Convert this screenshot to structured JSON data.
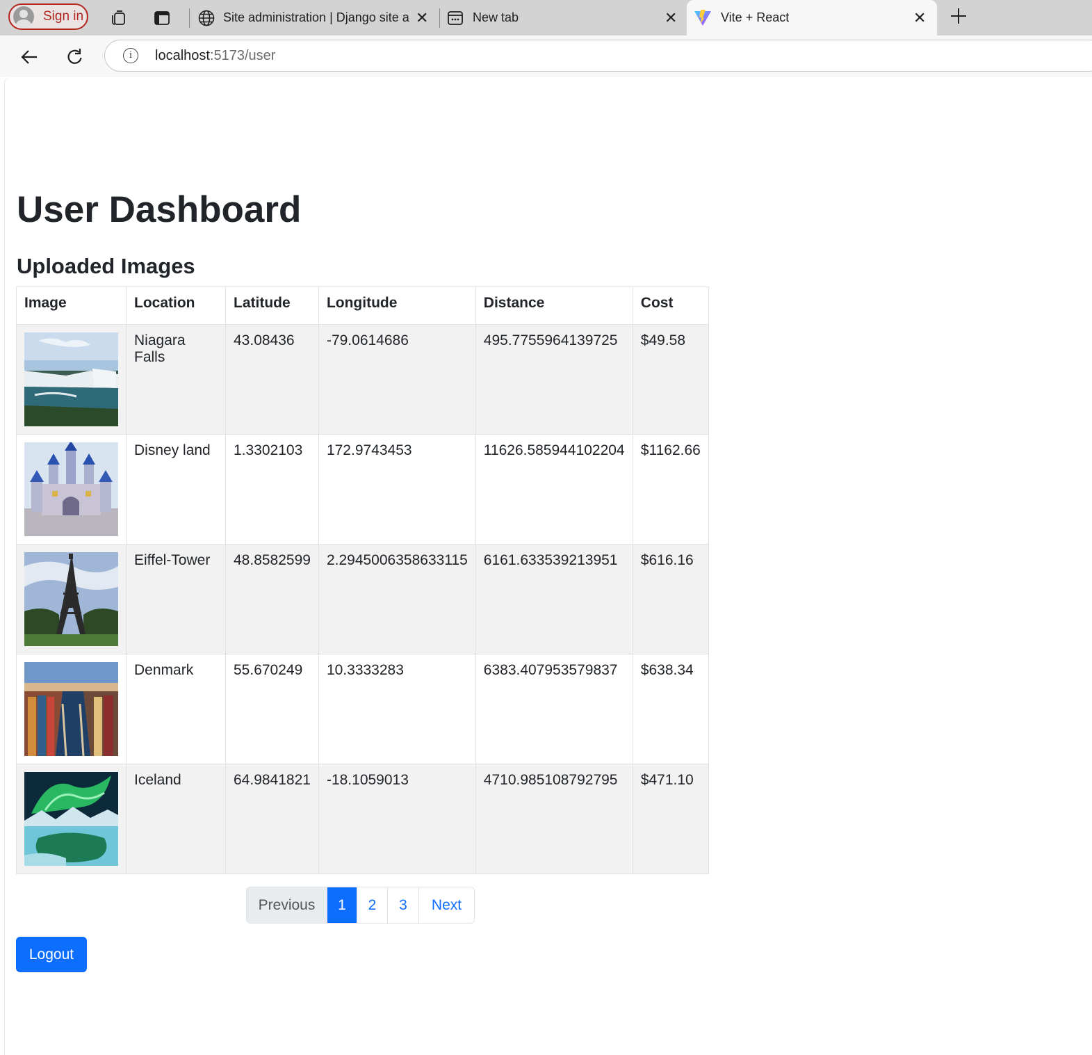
{
  "browser": {
    "signin_label": "Sign in",
    "tabs": [
      {
        "title": "Site administration | Django site a",
        "icon": "globe-icon"
      },
      {
        "title": "New tab",
        "icon": "newtab-icon"
      },
      {
        "title": "Vite + React",
        "icon": "vite-icon"
      }
    ],
    "url_host": "localhost",
    "url_path": ":5173/user"
  },
  "page": {
    "title": "User Dashboard",
    "section_title": "Uploaded Images",
    "columns": [
      "Image",
      "Location",
      "Latitude",
      "Longitude",
      "Distance",
      "Cost"
    ],
    "rows": [
      {
        "image": "Niagara Falls photo",
        "location": "Niagara Falls",
        "latitude": "43.08436",
        "longitude": "-79.0614686",
        "distance": "495.7755964139725",
        "cost": "$49.58"
      },
      {
        "image": "Disneyland castle photo",
        "location": "Disney land",
        "latitude": "1.3302103",
        "longitude": "172.9743453",
        "distance": "11626.585944102204",
        "cost": "$1162.66"
      },
      {
        "image": "Eiffel Tower photo",
        "location": "Eiffel-Tower",
        "latitude": "48.8582599",
        "longitude": "2.2945006358633115",
        "distance": "6161.633539213951",
        "cost": "$616.16"
      },
      {
        "image": "Copenhagen canal photo",
        "location": "Denmark",
        "latitude": "55.670249",
        "longitude": "10.3333283",
        "distance": "6383.407953579837",
        "cost": "$638.34"
      },
      {
        "image": "Aurora over Iceland photo",
        "location": "Iceland",
        "latitude": "64.9841821",
        "longitude": "-18.1059013",
        "distance": "4710.985108792795",
        "cost": "$471.10"
      }
    ],
    "pagination": {
      "previous": "Previous",
      "pages": [
        "1",
        "2",
        "3"
      ],
      "current": "1",
      "next": "Next"
    },
    "logout_label": "Logout"
  },
  "colors": {
    "primary": "#0d6efd",
    "stripe": "#f2f2f2",
    "signin": "#b3261e"
  }
}
